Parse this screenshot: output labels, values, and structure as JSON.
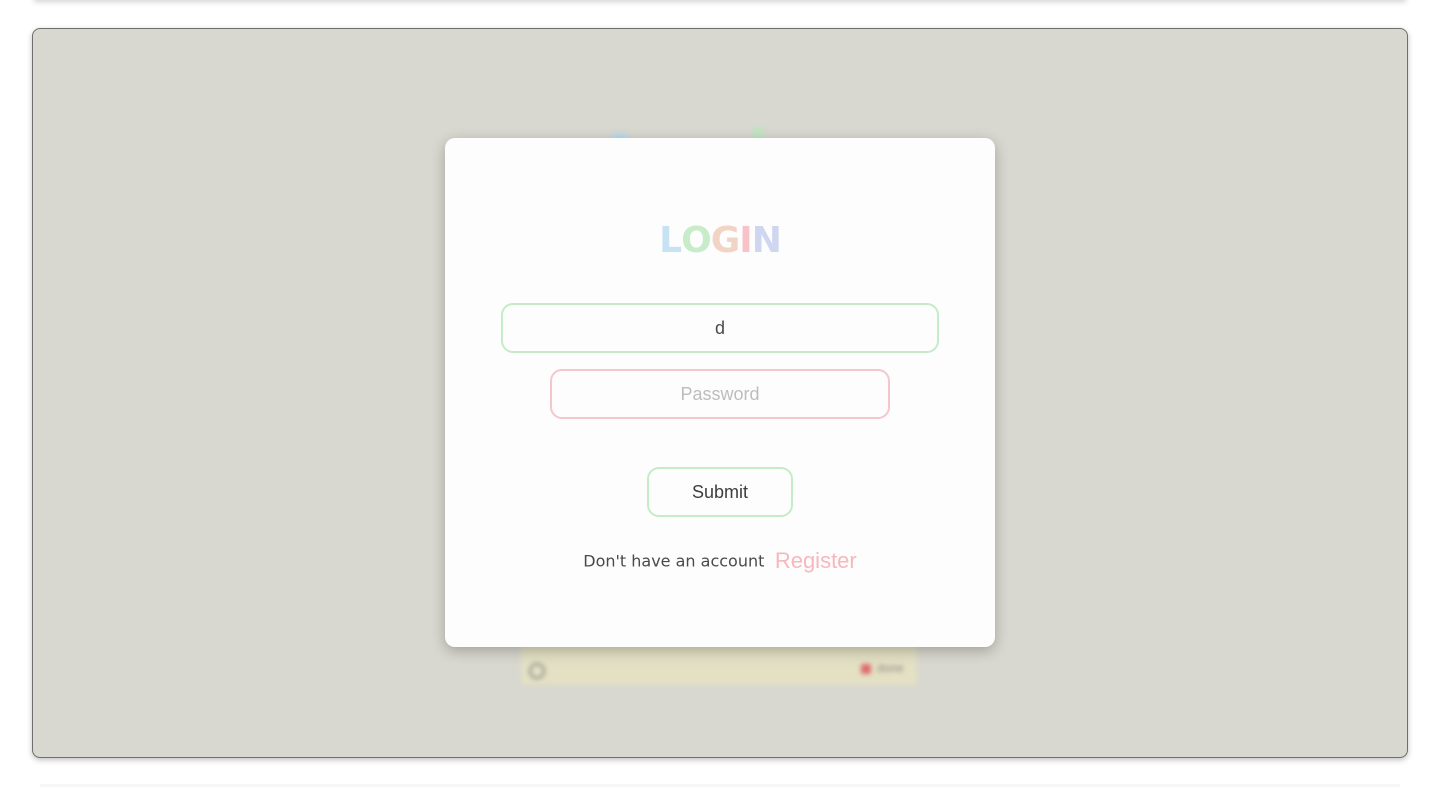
{
  "login": {
    "title_letters": [
      {
        "char": "L",
        "color": "#c5e3f2"
      },
      {
        "char": "O",
        "color": "#c8ecc9"
      },
      {
        "char": "G",
        "color": "#f2d4c5"
      },
      {
        "char": "I",
        "color": "#f7c3c9"
      },
      {
        "char": "N",
        "color": "#cfd6ef"
      }
    ],
    "username_value": "d",
    "password_placeholder": "Password",
    "submit_label": "Submit",
    "no_account_text": "Don't have an account",
    "register_label": "Register"
  },
  "background_app": {
    "task_text": "",
    "task_status": "done"
  },
  "colors": {
    "overlay": "#d8d8d0",
    "card": "#fdfdfd",
    "green_border": "#c4ecc6",
    "pink_border": "#f5c6cc",
    "register": "#f7b7bd"
  }
}
